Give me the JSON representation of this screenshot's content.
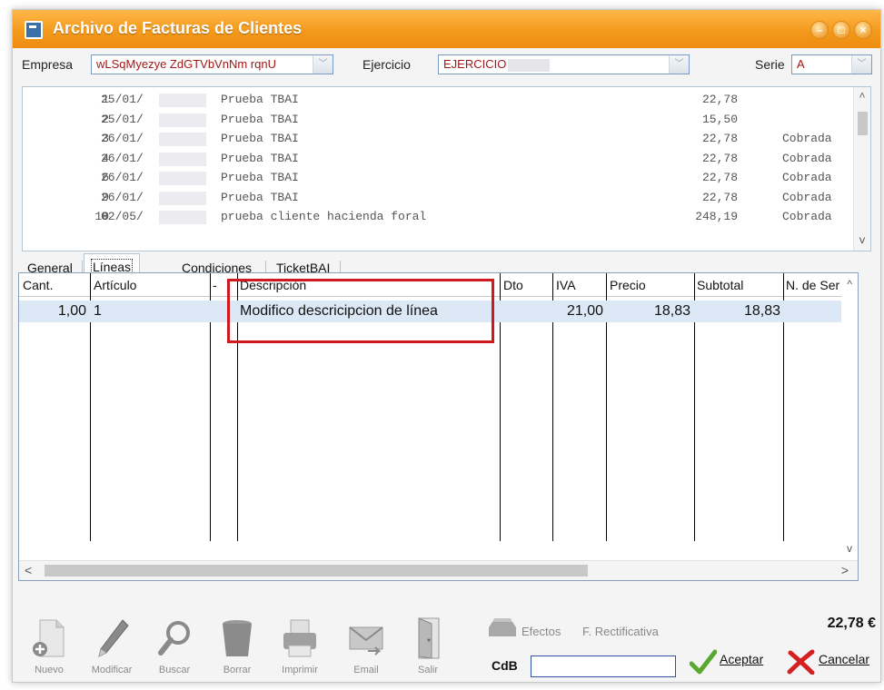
{
  "window": {
    "title": "Archivo de Facturas de Clientes",
    "controls": {
      "minimize": "–",
      "maximize": "□",
      "close": "×"
    }
  },
  "top": {
    "empresa_label": "Empresa",
    "empresa_value": "wLSqMyezye ZdGTVbVnNm rqnU",
    "ejercicio_label": "Ejercicio",
    "ejercicio_value": "EJERCICIO",
    "serie_label": "Serie",
    "serie_value": "A"
  },
  "invoices": [
    {
      "num": "1",
      "date": "25/01/",
      "desc": "Prueba TBAI",
      "amount": "22,78",
      "status": ""
    },
    {
      "num": "2",
      "date": "25/01/",
      "desc": "Prueba TBAI",
      "amount": "15,50",
      "status": ""
    },
    {
      "num": "3",
      "date": "26/01/",
      "desc": "Prueba TBAI",
      "amount": "22,78",
      "status": "Cobrada"
    },
    {
      "num": "4",
      "date": "26/01/",
      "desc": "Prueba TBAI",
      "amount": "22,78",
      "status": "Cobrada"
    },
    {
      "num": "6",
      "date": "26/01/",
      "desc": "Prueba TBAI",
      "amount": "22,78",
      "status": "Cobrada"
    },
    {
      "num": "9",
      "date": "26/01/",
      "desc": "Prueba TBAI",
      "amount": "22,78",
      "status": "Cobrada"
    },
    {
      "num": "10",
      "date": "02/05/",
      "desc": "prueba  cliente hacienda foral",
      "amount": "248,19",
      "status": "Cobrada"
    }
  ],
  "tabs": [
    "General",
    "Líneas",
    "Condiciones",
    "TicketBAI"
  ],
  "lines": {
    "headers": {
      "cant": "Cant.",
      "articulo": "Artículo",
      "dash": "-",
      "descripcion": "Descripción",
      "dto": "Dto",
      "iva": "IVA",
      "precio": "Precio",
      "subtotal": "Subtotal",
      "serie": "N. de Serie"
    },
    "rows": [
      {
        "cant": "1,00",
        "articulo": "1",
        "descripcion": "Modifico descricipcion de línea",
        "dto": "",
        "iva": "21,00",
        "precio": "18,83",
        "subtotal": "18,83"
      }
    ]
  },
  "toolbar": {
    "nuevo": "Nuevo",
    "modificar": "Modificar",
    "buscar": "Buscar",
    "borrar": "Borrar",
    "imprimir": "Imprimir",
    "email": "Email",
    "salir": "Salir"
  },
  "footer": {
    "efectos": "Efectos",
    "rectificativa": "F. Rectificativa",
    "total": "22,78 €",
    "cdb_label": "CdB",
    "cdb_value": "",
    "aceptar": "Aceptar",
    "cancelar": "Cancelar"
  },
  "colors": {
    "titlebar": "#f39a1c",
    "highlight": "#d0191f",
    "field_text": "#a01818",
    "selected_row": "#dde8f6"
  }
}
